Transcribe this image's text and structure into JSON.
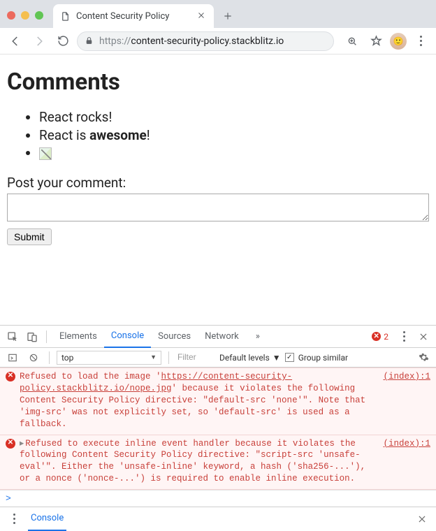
{
  "browser": {
    "tab_title": "Content Security Policy",
    "url_scheme": "https://",
    "url_host": "content-security-policy.stackblitz.io"
  },
  "page": {
    "heading": "Comments",
    "comments": [
      {
        "html": "React rocks!"
      },
      {
        "html": "React is <b>awesome</b>!"
      }
    ],
    "form_label": "Post your comment:",
    "textarea_value": "",
    "submit_label": "Submit"
  },
  "devtools": {
    "tabs": [
      "Elements",
      "Console",
      "Sources",
      "Network"
    ],
    "active_tab": "Console",
    "more_symbol": "»",
    "error_count": "2",
    "context": "top",
    "filter_placeholder": "Filter",
    "levels_label": "Default levels",
    "group_label": "Group similar",
    "messages": [
      {
        "source": "(index):1",
        "expandable": false,
        "text": "Refused to load the image '<u>https://content-security-policy.stackblitz.io/nope.jpg</u>' because it violates the following Content Security Policy directive: \"default-src 'none'\". Note that 'img-src' was not explicitly set, so 'default-src' is used as a fallback."
      },
      {
        "source": "(index):1",
        "expandable": true,
        "text": "Refused to execute inline event handler because it violates the following Content Security Policy directive: \"script-src 'unsafe-eval'\". Either the 'unsafe-inline' keyword, a hash ('sha256-...'), or a nonce ('nonce-...') is required to enable inline execution."
      }
    ],
    "prompt": ">",
    "drawer_label": "Console"
  }
}
